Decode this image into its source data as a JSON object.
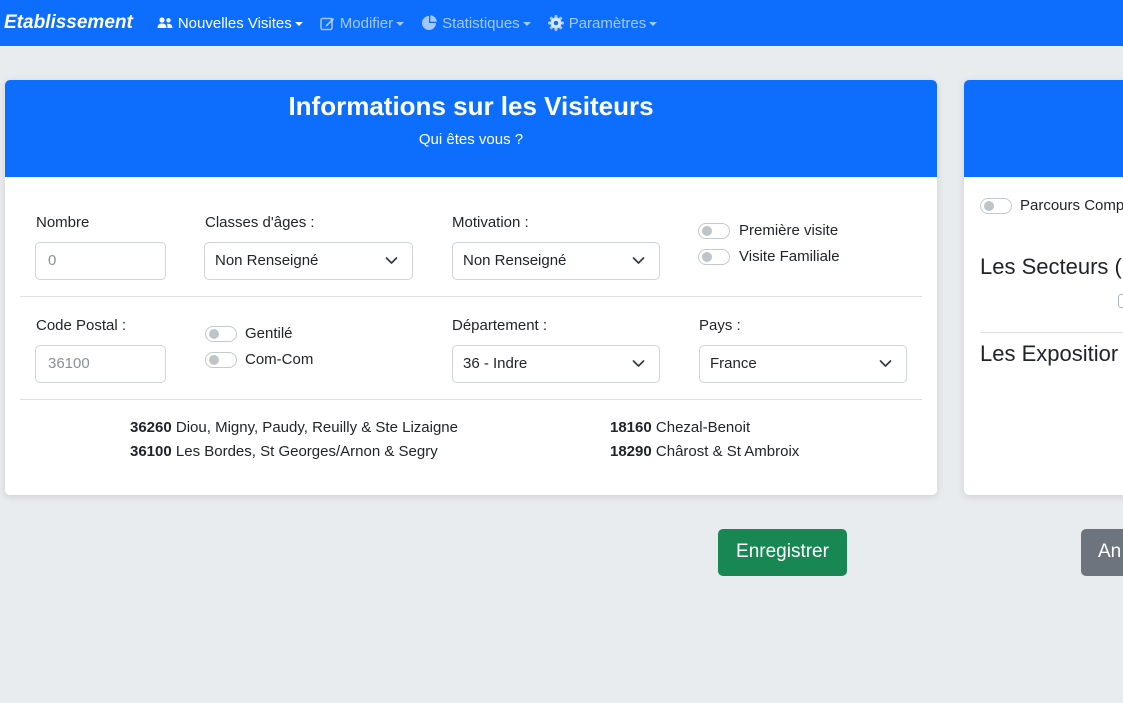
{
  "navbar": {
    "brand": "Etablissement",
    "items": [
      {
        "label": "Nouvelles Visites",
        "icon": "users-icon"
      },
      {
        "label": "Modifier",
        "icon": "edit-icon"
      },
      {
        "label": "Statistiques",
        "icon": "pie-chart-icon"
      },
      {
        "label": "Paramètres",
        "icon": "gear-icon"
      }
    ]
  },
  "visitor_card": {
    "title": "Informations sur les Visiteurs",
    "subtitle": "Qui êtes vous ?",
    "nombre": {
      "label": "Nombre",
      "placeholder": "0"
    },
    "classes_ages": {
      "label": "Classes d'âges :",
      "selected": "Non Renseigné"
    },
    "motivation": {
      "label": "Motivation :",
      "selected": "Non Renseigné"
    },
    "toggles_top": [
      {
        "label": "Première visite",
        "checked": false
      },
      {
        "label": "Visite Familiale",
        "checked": false
      }
    ],
    "code_postal": {
      "label": "Code Postal :",
      "placeholder": "36100"
    },
    "toggles_mid": [
      {
        "label": "Gentilé",
        "checked": false
      },
      {
        "label": "Com-Com",
        "checked": false
      }
    ],
    "departement": {
      "label": "Département :",
      "selected": "36 - Indre"
    },
    "pays": {
      "label": "Pays :",
      "selected": "France"
    },
    "communes": [
      {
        "code": "36260",
        "names": "Diou, Migny, Paudy, Reuilly & Ste Lizaigne"
      },
      {
        "code": "36100",
        "names": "Les Bordes, St Georges/Arnon & Segry"
      },
      {
        "code": "18160",
        "names": "Chezal-Benoit"
      },
      {
        "code": "18290",
        "names": "Chârost & St Ambroix"
      }
    ]
  },
  "side_card": {
    "toggle_label": "Parcours Comp",
    "secteurs_title": "Les Secteurs (",
    "expositions_title": "Les Expositior"
  },
  "buttons": {
    "save": "Enregistrer",
    "cancel": "An"
  },
  "colors": {
    "primary": "#0d6efd",
    "success": "#198754",
    "secondary": "#6c757d",
    "background": "#e9ecef"
  }
}
